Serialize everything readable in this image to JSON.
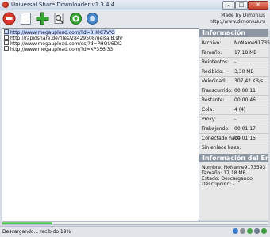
{
  "window": {
    "title": "Universal Share Downloader v1.3.4.4",
    "controls": {
      "minimize": "–",
      "maximize": "□",
      "close": "✕"
    }
  },
  "toolbar": {
    "buttons": [
      {
        "icon": "stop-icon",
        "color": "#d9382a"
      },
      {
        "icon": "blank-page-icon",
        "color": "#ffffff"
      },
      {
        "icon": "add-icon",
        "color": "#3aa335"
      },
      {
        "icon": "search-document-icon",
        "color": "#7a7f87"
      },
      {
        "icon": "settings-icon",
        "color": "#3aa335"
      },
      {
        "icon": "help-icon",
        "color": "#4a88c9"
      }
    ],
    "made_by": "Made by Dimonius",
    "website": "http://www.dimonius.ru"
  },
  "downloads": [
    {
      "url": "http://www.megaupload.com/?d=0H0C7V/G",
      "selected": true
    },
    {
      "url": "http://rapidshare.de/files/28429508/geisalB.shr",
      "selected": false
    },
    {
      "url": "http://www.megaupload.com/es/?d=PHQU6DI2",
      "selected": false
    },
    {
      "url": "http://www.megaupload.com/?d=XP3S6I33",
      "selected": false
    }
  ],
  "info": {
    "title": "Información",
    "rows": [
      {
        "label": "Archivo:",
        "value": "NoName9173593"
      },
      {
        "label": "Tamaño:",
        "value": "17,18 MB"
      },
      {
        "label": "Reintentos:",
        "value": "-"
      },
      {
        "label": "Recibido:",
        "value": "3,30 MB"
      },
      {
        "label": "Velocidad:",
        "value": "307,42 KB/s"
      },
      {
        "label": "Transcurrido:",
        "value": "00:00:11"
      },
      {
        "label": "Restante:",
        "value": "00:00:46"
      },
      {
        "label": "Cola:",
        "value": "4 (4)"
      },
      {
        "label": "Proxy:",
        "value": "-"
      },
      {
        "label": "Trabajando:",
        "value": "00:01:17"
      },
      {
        "label": "Conectado hace:",
        "value": "00:01:15"
      },
      {
        "label": "Sin enlace hace:",
        "value": "-"
      }
    ]
  },
  "link_info": {
    "title": "Información del Enla",
    "lines": [
      "Nombre: NoName9173593",
      "Tamaño: 17,18 MB",
      "Estado: Descargando",
      "Descripción: -"
    ]
  },
  "progress": {
    "fraction": 0.19
  },
  "status": {
    "text": "Descargando... recibido 19%",
    "icons": [
      "internet-icon",
      "link-icon",
      "plugin-icon",
      "network-icon",
      "power-icon"
    ]
  }
}
